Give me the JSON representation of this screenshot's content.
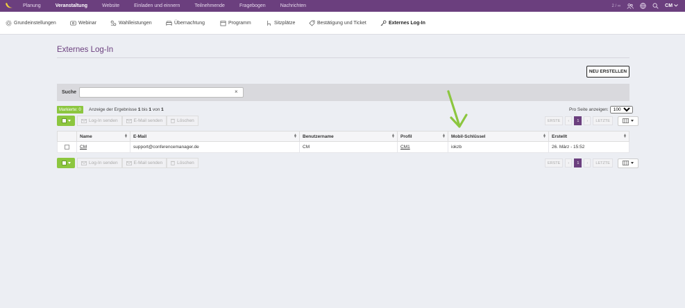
{
  "topnav": {
    "items": [
      "Planung",
      "Veranstaltung",
      "Website",
      "Einladen und einnern",
      "Teilnehmende",
      "Fragebogen",
      "Nachrichten"
    ],
    "active_index": 1,
    "count": "2 / ∞",
    "user": "CM"
  },
  "subnav": {
    "items": [
      {
        "label": "Grundeinstellungen",
        "icon": "gear-icon"
      },
      {
        "label": "Webinar",
        "icon": "video-icon"
      },
      {
        "label": "Wahlleistungen",
        "icon": "options-icon"
      },
      {
        "label": "Übernachtung",
        "icon": "bed-icon"
      },
      {
        "label": "Programm",
        "icon": "calendar-icon"
      },
      {
        "label": "Sitzplätze",
        "icon": "seat-icon"
      },
      {
        "label": "Bestätigung und Ticket",
        "icon": "ticket-icon"
      },
      {
        "label": "Externes Log-In",
        "icon": "key-icon"
      }
    ],
    "active_index": 7
  },
  "page": {
    "title": "Externes Log-In"
  },
  "new_button": "NEU ERSTELLEN",
  "search": {
    "label": "Suche",
    "value": "",
    "clear": "×"
  },
  "marked": "Markierte: 0",
  "results": {
    "prefix": "Anzeige der Ergebnisse",
    "from": "1",
    "bis": "bis",
    "to": "1",
    "von": "von",
    "total": "1"
  },
  "perpage": {
    "label": "Pro Seite anzeigen:",
    "value": "100"
  },
  "toolbar": {
    "login_send": "Log-In senden",
    "email_send": "E-Mail senden",
    "delete": "Löschen"
  },
  "pager": {
    "first": "ERSTE",
    "prev": "‹",
    "current": "1",
    "next": "›",
    "last": "LETZTE"
  },
  "table": {
    "headers": [
      "Name",
      "E-Mail",
      "Benutzername",
      "Profil",
      "Mobil-Schlüssel",
      "Erstellt"
    ],
    "rows": [
      {
        "name": "CM",
        "email": "support@conferencemanager.de",
        "username": "CM",
        "profile": "CM1",
        "key": "iokzb",
        "created": "26. März - 15:52"
      }
    ]
  },
  "colors": {
    "brand": "#6b3f7e",
    "accent": "#8cc63f",
    "arrow": "#8cc63f"
  }
}
